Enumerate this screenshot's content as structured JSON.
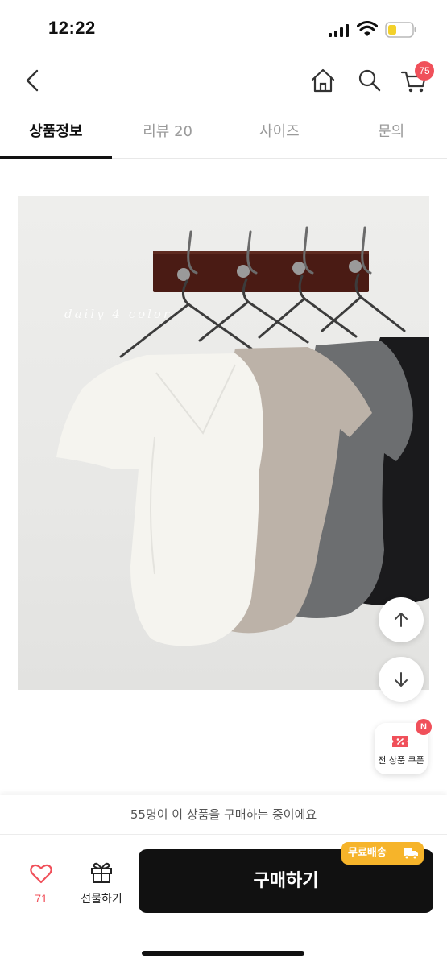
{
  "status_bar": {
    "time": "12:22"
  },
  "header": {
    "cart_count": "75"
  },
  "tabs": [
    {
      "label": "상품정보",
      "active": true
    },
    {
      "label": "리뷰 20",
      "active": false
    },
    {
      "label": "사이즈",
      "active": false
    },
    {
      "label": "문의",
      "active": false
    }
  ],
  "product_image": {
    "caption": "daily 4 color"
  },
  "coupon": {
    "label": "전 상품 쿠폰",
    "badge": "N"
  },
  "purchase_bar": {
    "buyers_notice": "55명이 이 상품을 구매하는 중이에요",
    "like_count": "71",
    "gift_label": "선물하기",
    "buy_label": "구매하기",
    "shipping_badge": "무료배송"
  },
  "colors": {
    "accent_red": "#f0505a",
    "badge_yellow": "#f6b42a",
    "buy_black": "#111111"
  }
}
